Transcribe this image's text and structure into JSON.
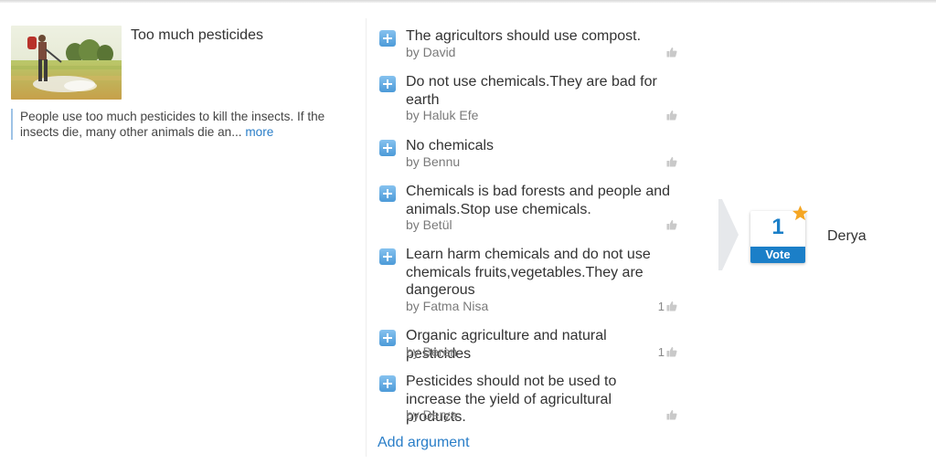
{
  "problem": {
    "title": "Too much pesticides",
    "description": "People use too much pesticides to kill the insects. If the insects die, many other animals die an...",
    "more_label": "more"
  },
  "arguments": [
    {
      "text": "The agricultors should use compost.",
      "author": "by David",
      "likes": ""
    },
    {
      "text": "Do not use chemicals.They are bad for earth",
      "author": "by Haluk Efe",
      "likes": ""
    },
    {
      "text": "No chemicals",
      "author": "by Bennu",
      "likes": ""
    },
    {
      "text": "Chemicals is bad forests and people and animals.Stop use chemicals.",
      "author": "by Betül",
      "likes": ""
    },
    {
      "text": "Learn harm chemicals and do not use chemicals fruits,vegetables.They are dangerous",
      "author": "by Fatma Nisa",
      "likes": "1"
    },
    {
      "text": "Organic agriculture and natural pesticides",
      "author": "by Beren",
      "likes": "1"
    },
    {
      "text": "Pesticides should not be used to increase the yield of agricultural products.",
      "author": "by Derya",
      "likes": ""
    }
  ],
  "add_argument_label": "Add argument",
  "vote": {
    "count": "1",
    "label": "Vote",
    "name": "Derya"
  },
  "colors": {
    "accent": "#1b7fc8",
    "link": "#2a7ec8",
    "star": "#f5a623"
  },
  "icons": {
    "expand": "plus-icon",
    "like": "thumbs-up-icon",
    "favorite": "star-icon"
  }
}
